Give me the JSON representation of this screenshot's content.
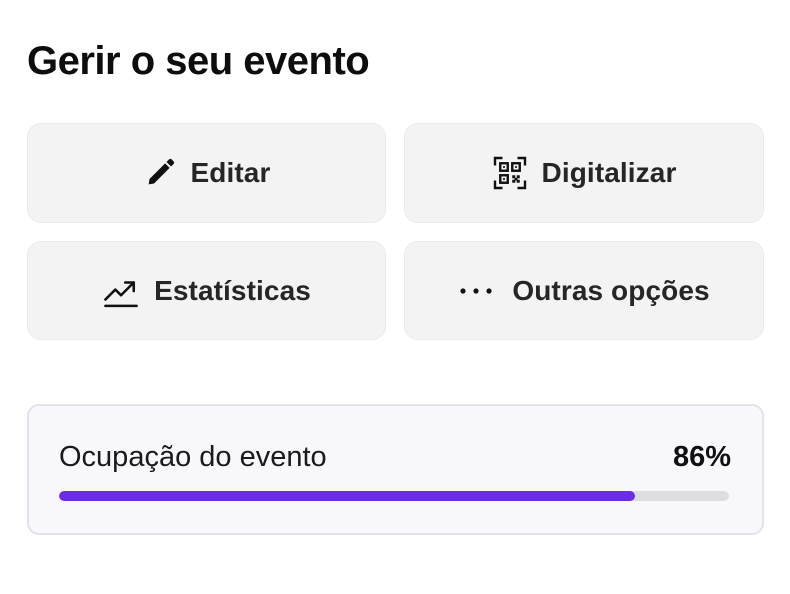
{
  "page": {
    "title": "Gerir o seu evento"
  },
  "actions": [
    {
      "label": "Editar",
      "icon": "pencil-icon"
    },
    {
      "label": "Digitalizar",
      "icon": "qr-code-icon"
    },
    {
      "label": "Estatísticas",
      "icon": "trending-up-icon"
    },
    {
      "label": "Outras opções",
      "icon": "more-horizontal-icon"
    }
  ],
  "occupancy": {
    "label": "Ocupação do evento",
    "value_text": "86%",
    "fraction": 0.86
  },
  "colors": {
    "accent": "#6a2ce6",
    "track": "#dddde0",
    "button_bg": "#f3f3f3"
  }
}
